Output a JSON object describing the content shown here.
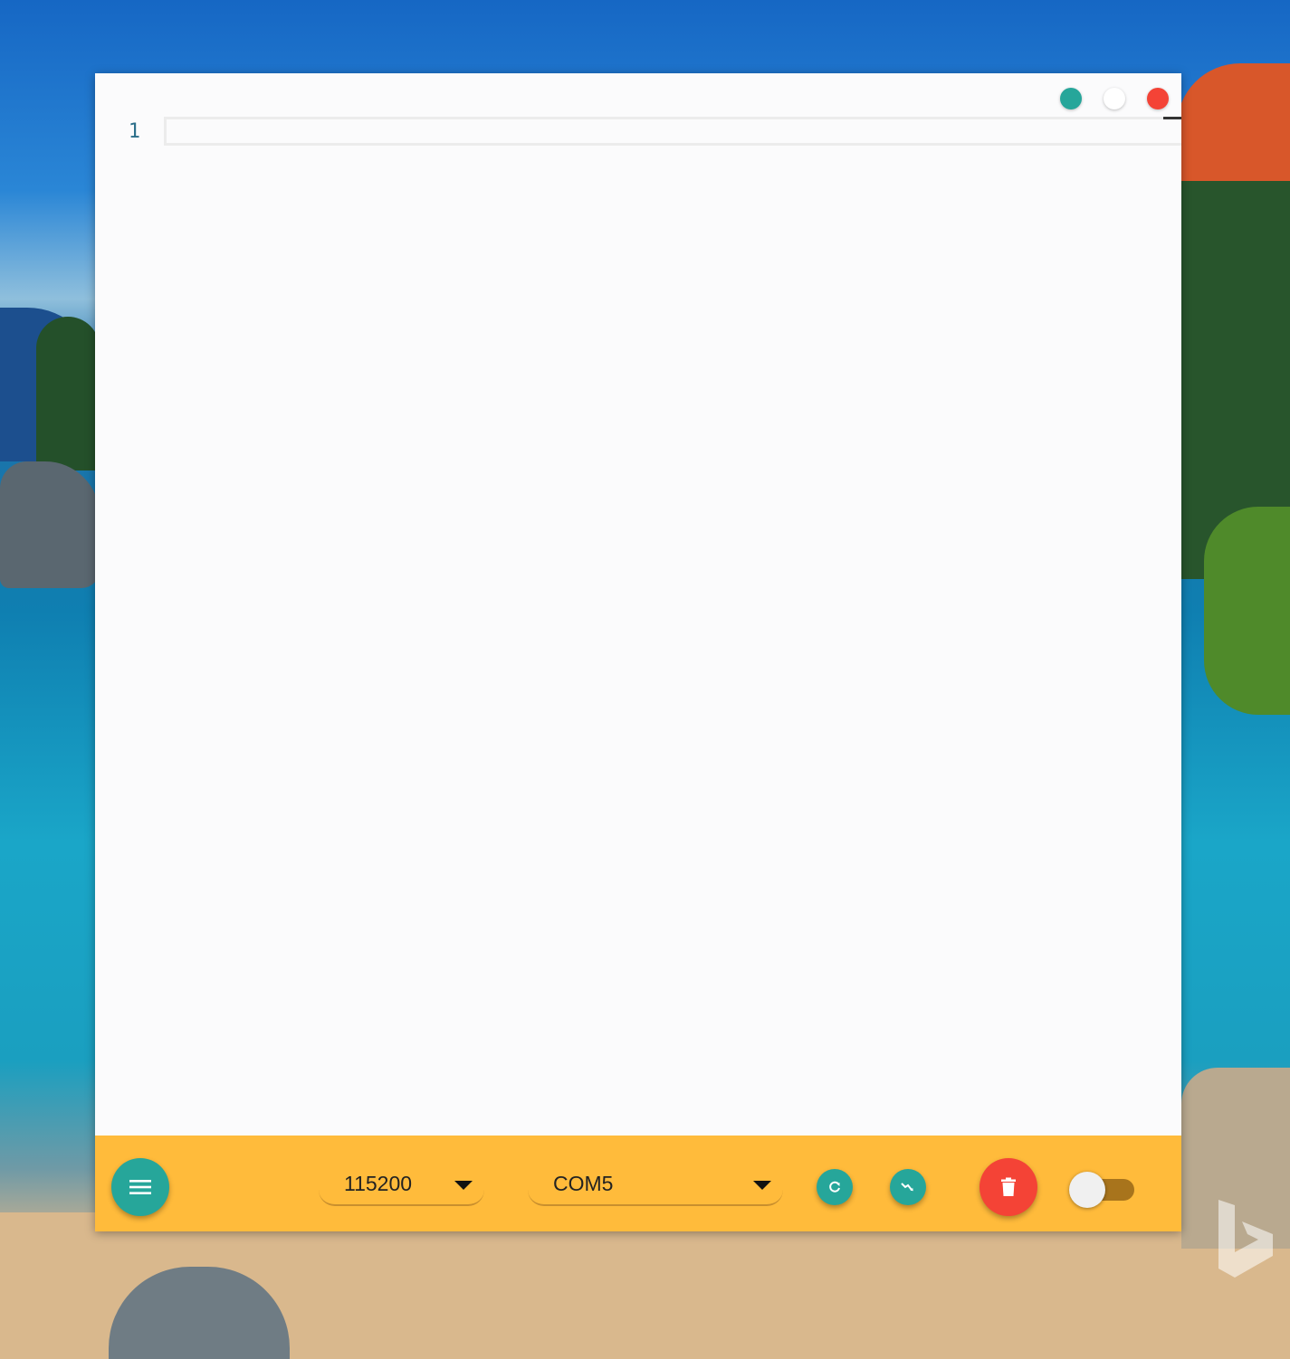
{
  "window": {
    "controls": {
      "minimize": "minimize",
      "maximize": "maximize",
      "close": "close"
    }
  },
  "editor": {
    "line_numbers": [
      "1"
    ],
    "content": ""
  },
  "footer": {
    "menu_icon": "menu-icon",
    "baud_rate": {
      "selected": "115200"
    },
    "port": {
      "selected": "COM5"
    },
    "refresh_icon": "refresh-icon",
    "plotter_icon": "chart-icon",
    "clear_icon": "trash-icon",
    "toggle_on": false
  },
  "colors": {
    "accent_teal": "#26a69a",
    "footer_amber": "#ffbb3b",
    "danger_red": "#f44336",
    "line_number": "#2c6f8a"
  }
}
